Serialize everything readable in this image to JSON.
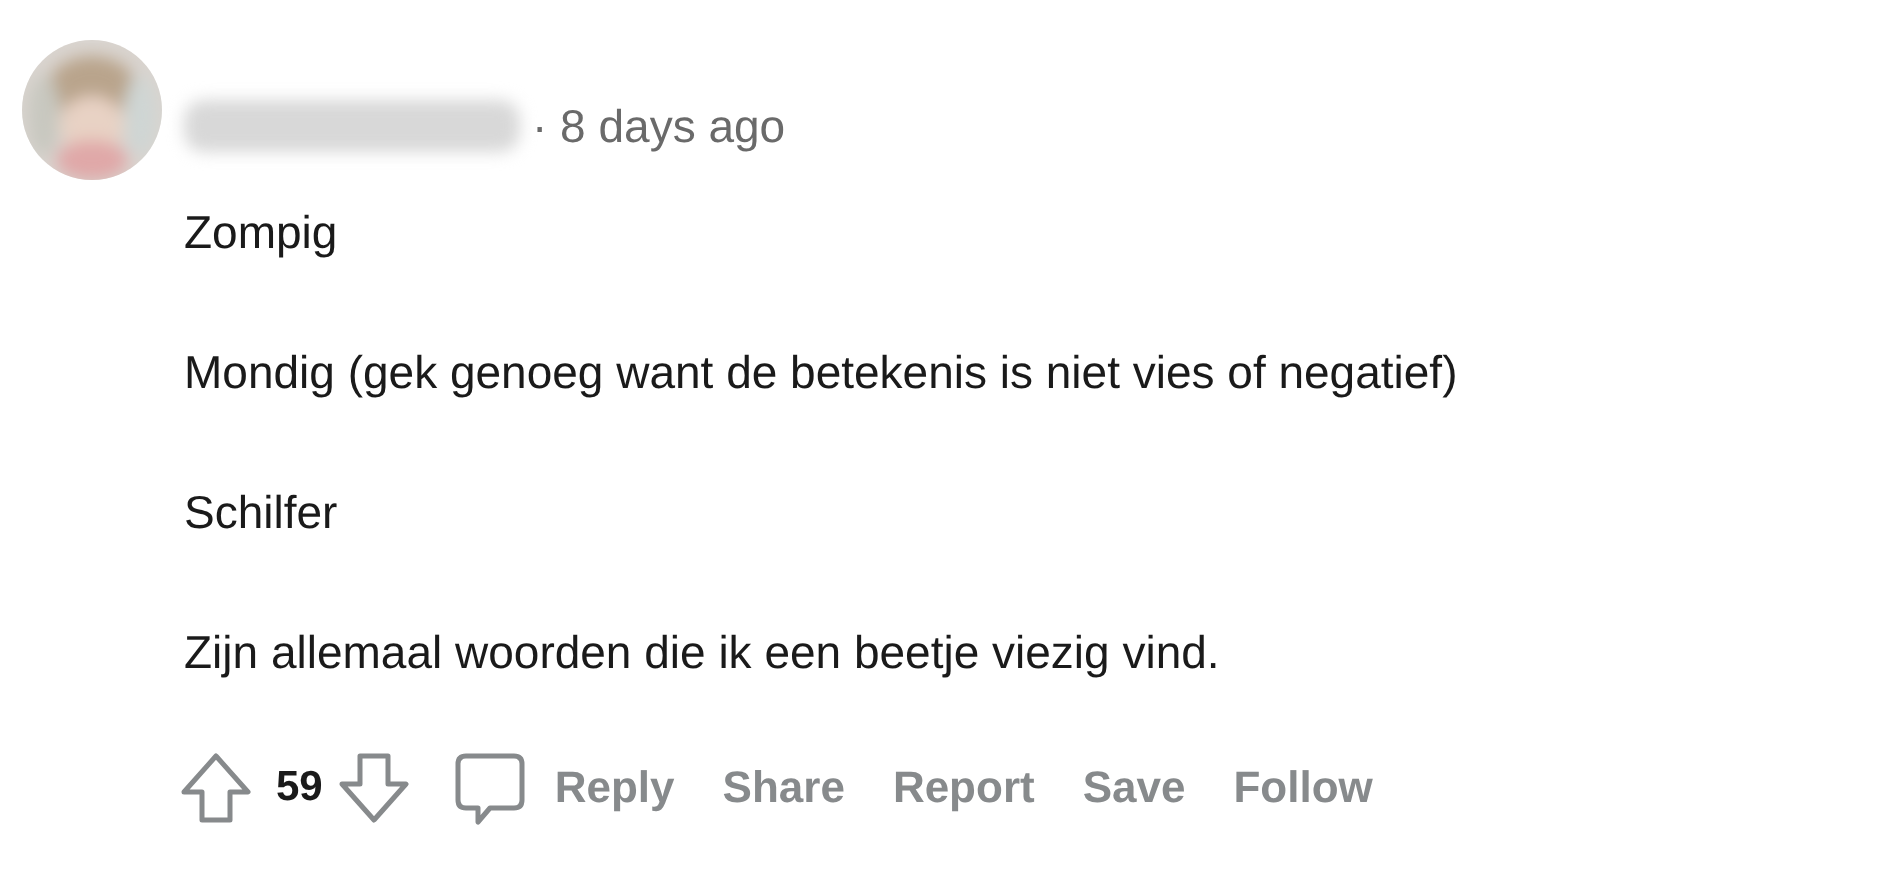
{
  "comment": {
    "timestamp": "· 8 days ago",
    "paragraphs": [
      "Zompig",
      "Mondig (gek genoeg want de betekenis is niet vies of negatief)",
      "Schilfer",
      "Zijn allemaal woorden die ik een beetje viezig vind."
    ],
    "score": "59",
    "actions": [
      "Reply",
      "Share",
      "Report",
      "Save",
      "Follow"
    ]
  }
}
